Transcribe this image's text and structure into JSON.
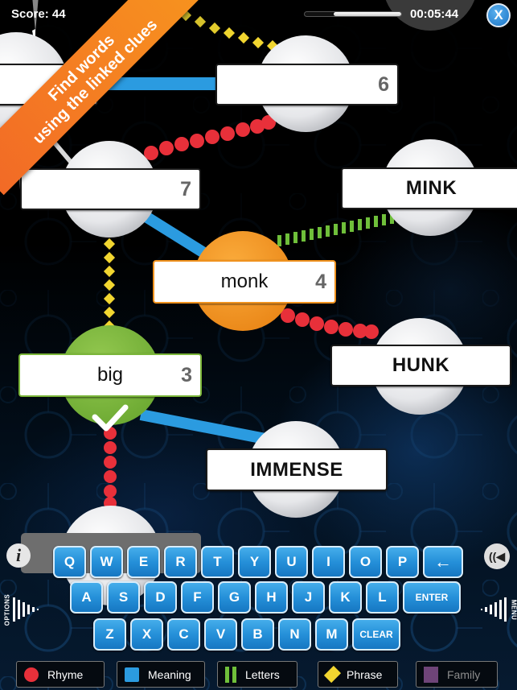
{
  "header": {
    "score_label": "Score: 44",
    "timer": "00:05:44",
    "time_progress": 0.7,
    "close_label": "X"
  },
  "banner": {
    "line1": "Find words",
    "line2": "using the linked clues"
  },
  "nodes": [
    {
      "id": "top-left",
      "word": "",
      "letters": "",
      "state": "hidden"
    },
    {
      "id": "six",
      "word": "",
      "letters": "6",
      "state": "unsolved"
    },
    {
      "id": "seven",
      "word": "",
      "letters": "7",
      "state": "unsolved"
    },
    {
      "id": "mink",
      "word": "MINK",
      "letters": "",
      "state": "clue"
    },
    {
      "id": "monk",
      "word": "monk",
      "letters": "4",
      "state": "active"
    },
    {
      "id": "hunk",
      "word": "HUNK",
      "letters": "",
      "state": "clue"
    },
    {
      "id": "big",
      "word": "big",
      "letters": "3",
      "state": "solved"
    },
    {
      "id": "immense",
      "word": "IMMENSE",
      "letters": "",
      "state": "clue"
    },
    {
      "id": "bottom",
      "word": "",
      "letters": "",
      "state": "unsolved"
    }
  ],
  "links": [
    {
      "from": "top-left",
      "to": "six",
      "type": "Meaning"
    },
    {
      "from": "top-left",
      "to": "six",
      "type": "Phrase"
    },
    {
      "from": "seven",
      "to": "six",
      "type": "Rhyme"
    },
    {
      "from": "seven",
      "to": "monk",
      "type": "Meaning"
    },
    {
      "from": "seven",
      "to": "big",
      "type": "Phrase"
    },
    {
      "from": "monk",
      "to": "mink",
      "type": "Letters"
    },
    {
      "from": "monk",
      "to": "hunk",
      "type": "Rhyme"
    },
    {
      "from": "big",
      "to": "immense",
      "type": "Meaning"
    },
    {
      "from": "big",
      "to": "bottom",
      "type": "Rhyme"
    }
  ],
  "keyboard": {
    "row1": [
      "Q",
      "W",
      "E",
      "R",
      "T",
      "Y",
      "U",
      "I",
      "O",
      "P",
      "←"
    ],
    "row2": [
      "A",
      "S",
      "D",
      "F",
      "G",
      "H",
      "J",
      "K",
      "L",
      "ENTER"
    ],
    "row3": [
      "Z",
      "X",
      "C",
      "V",
      "B",
      "N",
      "M",
      "CLEAR"
    ]
  },
  "side": {
    "options_label": "OPTIONS",
    "menu_label": "MENU",
    "info_label": "i",
    "sound_label": "((◀"
  },
  "legend": [
    {
      "label": "Rhyme",
      "icon": "red-circle",
      "color": "#e8303a",
      "enabled": true
    },
    {
      "label": "Meaning",
      "icon": "blue-square",
      "color": "#2b9be0",
      "enabled": true
    },
    {
      "label": "Letters",
      "icon": "green-bars",
      "color": "#6fbf3a",
      "enabled": true
    },
    {
      "label": "Phrase",
      "icon": "yellow-diamond",
      "color": "#f2d630",
      "enabled": true
    },
    {
      "label": "Family",
      "icon": "purple-square",
      "color": "#7a4a86",
      "enabled": false
    }
  ],
  "colors": {
    "active_node": "#f0921e",
    "solved_node": "#7bb63a",
    "key_blue": "#2590d9"
  }
}
